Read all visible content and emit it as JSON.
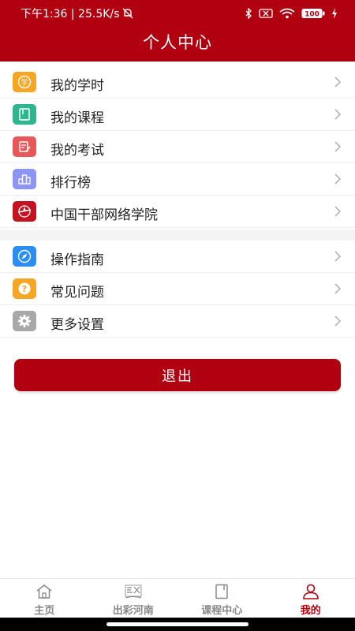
{
  "status": {
    "time_speed": "下午1:36 | 25.5K/s",
    "battery": "100"
  },
  "header": {
    "title": "个人中心"
  },
  "menu_group1": [
    {
      "label": "我的学时",
      "icon": "study-hours-icon",
      "color": "#f5a623"
    },
    {
      "label": "我的课程",
      "icon": "course-book-icon",
      "color": "#2fb58f"
    },
    {
      "label": "我的考试",
      "icon": "exam-icon",
      "color": "#e8575a"
    },
    {
      "label": "排行榜",
      "icon": "ranking-icon",
      "color": "#8d95f3"
    },
    {
      "label": "中国干部网络学院",
      "icon": "cadre-college-logo-icon",
      "color": "#c41220"
    }
  ],
  "menu_group2": [
    {
      "label": "操作指南",
      "icon": "compass-icon",
      "color": "#2b8ef0"
    },
    {
      "label": "常见问题",
      "icon": "question-icon",
      "color": "#f5a623"
    },
    {
      "label": "更多设置",
      "icon": "gear-icon",
      "color": "#a8a8a8"
    }
  ],
  "logout": {
    "label": "退出"
  },
  "tabbar": [
    {
      "label": "主页",
      "icon": "home-icon",
      "active": false
    },
    {
      "label": "出彩河南",
      "icon": "henan-icon",
      "active": false
    },
    {
      "label": "课程中心",
      "icon": "book-icon",
      "active": false
    },
    {
      "label": "我的",
      "icon": "person-icon",
      "active": true
    }
  ],
  "colors": {
    "brand": "#b1000f",
    "inactive_tab": "#888888"
  }
}
